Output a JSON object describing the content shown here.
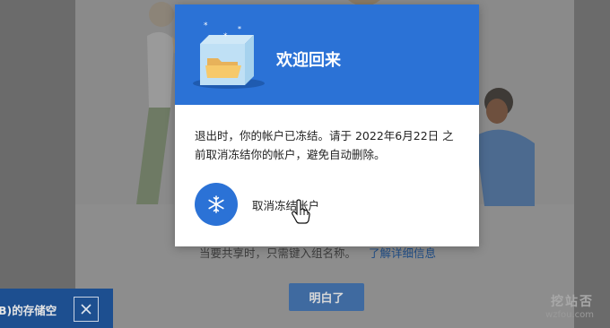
{
  "dialog": {
    "title": "欢迎回来",
    "message": "退出时，你的帐户已冻结。请于 2022年6月22日 之前取消冻结你的帐户，避免自动删除。",
    "unfreeze_label": "取消冻结帐户",
    "unfreeze_icon": "snowflake-icon",
    "header_color": "#2b72d6"
  },
  "background": {
    "hint_text": "当要共享时，只需键入组名称。",
    "hint_link": "了解详细信息",
    "ok_button": "明白了",
    "storage_notice": "B)的存储空",
    "close_icon": "close-icon"
  },
  "watermark": {
    "cn": "挖站否",
    "en": "wzfou.com"
  }
}
